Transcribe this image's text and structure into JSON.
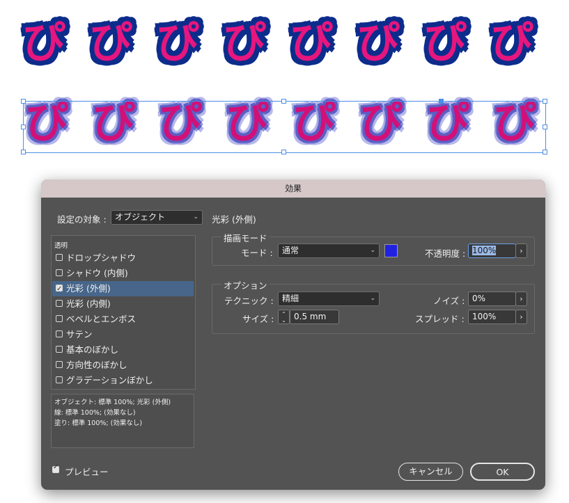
{
  "artwork": {
    "glyph": "ぴ",
    "count": 8,
    "colors": {
      "fill": "#e6167e",
      "glow_row1": "#0d2c8c",
      "glow_row2": "#5b5fc4",
      "selection": "#4b8ee6"
    }
  },
  "dialog": {
    "title": "効果",
    "settings_target_label": "設定の対象 :",
    "settings_target_value": "オブジェクト",
    "section_title": "光彩 (外側)",
    "list_header": "透明",
    "effects": [
      {
        "label": "ドロップシャドウ",
        "checked": false,
        "selected": false
      },
      {
        "label": "シャドウ (内側)",
        "checked": false,
        "selected": false
      },
      {
        "label": "光彩 (外側)",
        "checked": true,
        "selected": true
      },
      {
        "label": "光彩 (内側)",
        "checked": false,
        "selected": false
      },
      {
        "label": "ベベルとエンボス",
        "checked": false,
        "selected": false
      },
      {
        "label": "サテン",
        "checked": false,
        "selected": false
      },
      {
        "label": "基本のぼかし",
        "checked": false,
        "selected": false
      },
      {
        "label": "方向性のぼかし",
        "checked": false,
        "selected": false
      },
      {
        "label": "グラデーションぼかし",
        "checked": false,
        "selected": false
      }
    ],
    "summary": [
      "オブジェクト: 標準 100%; 光彩 (外側)",
      "線: 標準 100%; (効果なし)",
      "塗り: 標準 100%; (効果なし)"
    ],
    "blend": {
      "group_label": "描画モード",
      "mode_label": "モード :",
      "mode_value": "通常",
      "color": "#2121e0",
      "opacity_label": "不透明度 :",
      "opacity_value": "100%"
    },
    "options": {
      "group_label": "オプション",
      "technique_label": "テクニック :",
      "technique_value": "精細",
      "noise_label": "ノイズ :",
      "noise_value": "0%",
      "size_label": "サイズ :",
      "size_value": "0.5 mm",
      "spread_label": "スプレッド :",
      "spread_value": "100%"
    },
    "preview_label": "プレビュー",
    "preview_checked": true,
    "cancel_label": "キャンセル",
    "ok_label": "OK"
  }
}
